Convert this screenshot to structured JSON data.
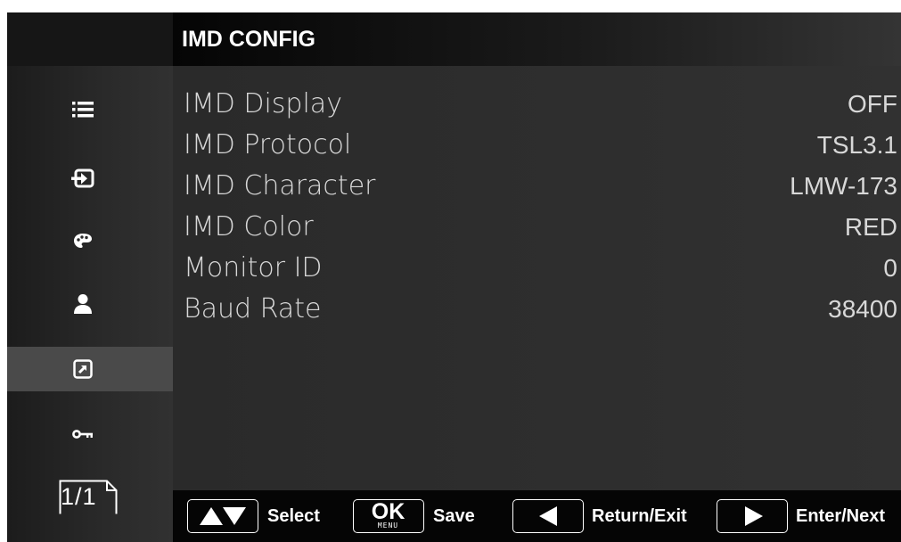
{
  "header": {
    "title": "IMD CONFIG"
  },
  "menu": [
    {
      "label": "IMD Display",
      "value": "OFF"
    },
    {
      "label": "IMD Protocol",
      "value": "TSL3.1"
    },
    {
      "label": "IMD Character",
      "value": "LMW-173"
    },
    {
      "label": "IMD Color",
      "value": "RED"
    },
    {
      "label": "Monitor ID",
      "value": "0"
    },
    {
      "label": "Baud Rate",
      "value": "38400"
    }
  ],
  "sidebar": {
    "items": [
      {
        "icon": "list-icon"
      },
      {
        "icon": "input-icon"
      },
      {
        "icon": "palette-icon"
      },
      {
        "icon": "user-icon"
      },
      {
        "icon": "shortcut-icon",
        "active": true
      },
      {
        "icon": "key-icon"
      }
    ],
    "page_indicator": "1/1"
  },
  "footer": {
    "select_label": "Select",
    "ok_key": "OK",
    "menu_key": "MENU",
    "save_label": "Save",
    "return_label": "Return/Exit",
    "enter_label": "Enter/Next"
  },
  "colors": {
    "active_row": "#4a4a4a",
    "text": "#d8d8d8",
    "footer_bg": "#050505"
  }
}
